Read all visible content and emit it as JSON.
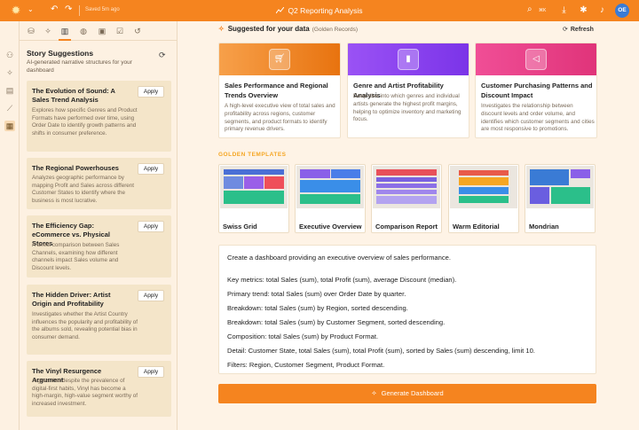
{
  "topbar": {
    "saved": "Saved 5m ago",
    "title": "Q2 Reporting Analysis",
    "search_kbd": "⌘K",
    "avatar": "OE",
    "accent": "#f5841f"
  },
  "panel": {
    "title": "Story Suggestions",
    "subtitle": "AI-generated narrative structures for your dashboard",
    "apply_label": "Apply",
    "stories": [
      {
        "title": "The Evolution of Sound: A Sales Trend Analysis",
        "desc": "Explores how specific Genres and Product Formats have performed over time, using Order Date to identify growth patterns and shifts in consumer preference."
      },
      {
        "title": "The Regional Powerhouses",
        "desc": "Analyzes geographic performance by mapping Profit and Sales across different Customer States to identify where the business is most lucrative."
      },
      {
        "title": "The Efficiency Gap: eCommerce vs. Physical Stores",
        "desc": "A direct comparison between Sales Channels, examining how different channels impact Sales volume and Discount levels."
      },
      {
        "title": "The Hidden Driver: Artist Origin and Profitability",
        "desc": "Investigates whether the Artist Country influences the popularity and profitability of the albums sold, revealing potential bias in consumer demand."
      },
      {
        "title": "The Vinyl Resurgence Argument",
        "desc": "Argues that despite the prevalence of digital-first habits, Vinyl has become a high-margin, high-value segment worthy of increased investment."
      }
    ]
  },
  "main": {
    "suggested_title": "Suggested for your data",
    "suggested_sub": "(Golden Records)",
    "refresh_label": "Refresh",
    "cards": [
      {
        "title": "Sales Performance and Regional Trends Overview",
        "desc": "A high-level executive view of total sales and profitability across regions, customer segments, and product formats to identify primary revenue drivers.",
        "icon": "cart-icon",
        "color": "#f5841f"
      },
      {
        "title": "Genre and Artist Profitability Analysis",
        "desc": "Deep-dive into which genres and individual artists generate the highest profit margins, helping to optimize inventory and marketing focus.",
        "icon": "bar-chart-icon",
        "color": "#8b3ff0"
      },
      {
        "title": "Customer Purchasing Patterns and Discount Impact",
        "desc": "Investigates the relationship between discount levels and order volume, and identifies which customer segments and cities are most responsive to promotions.",
        "icon": "megaphone-icon",
        "color": "#ec3f8b"
      }
    ],
    "golden_label": "GOLDEN TEMPLATES",
    "templates": [
      {
        "name": "Swiss Grid"
      },
      {
        "name": "Executive Overview"
      },
      {
        "name": "Comparison Report"
      },
      {
        "name": "Warm Editorial"
      },
      {
        "name": "Mondrian"
      }
    ],
    "prompt_lines": [
      "Create a dashboard providing an executive overview of sales performance.",
      "",
      "Key metrics: total Sales (sum), total Profit (sum), average Discount (median).",
      "Primary trend: total Sales (sum) over Order Date by quarter.",
      "Breakdown: total Sales (sum) by Region, sorted descending.",
      "Breakdown: total Sales (sum) by Customer Segment, sorted descending.",
      "Composition: total Sales (sum) by Product Format.",
      "Detail: Customer State, total Sales (sum), total Profit (sum), sorted by Sales (sum) descending, limit 10.",
      "Filters: Region, Customer Segment, Product Format."
    ],
    "generate_label": "Generate Dashboard"
  }
}
